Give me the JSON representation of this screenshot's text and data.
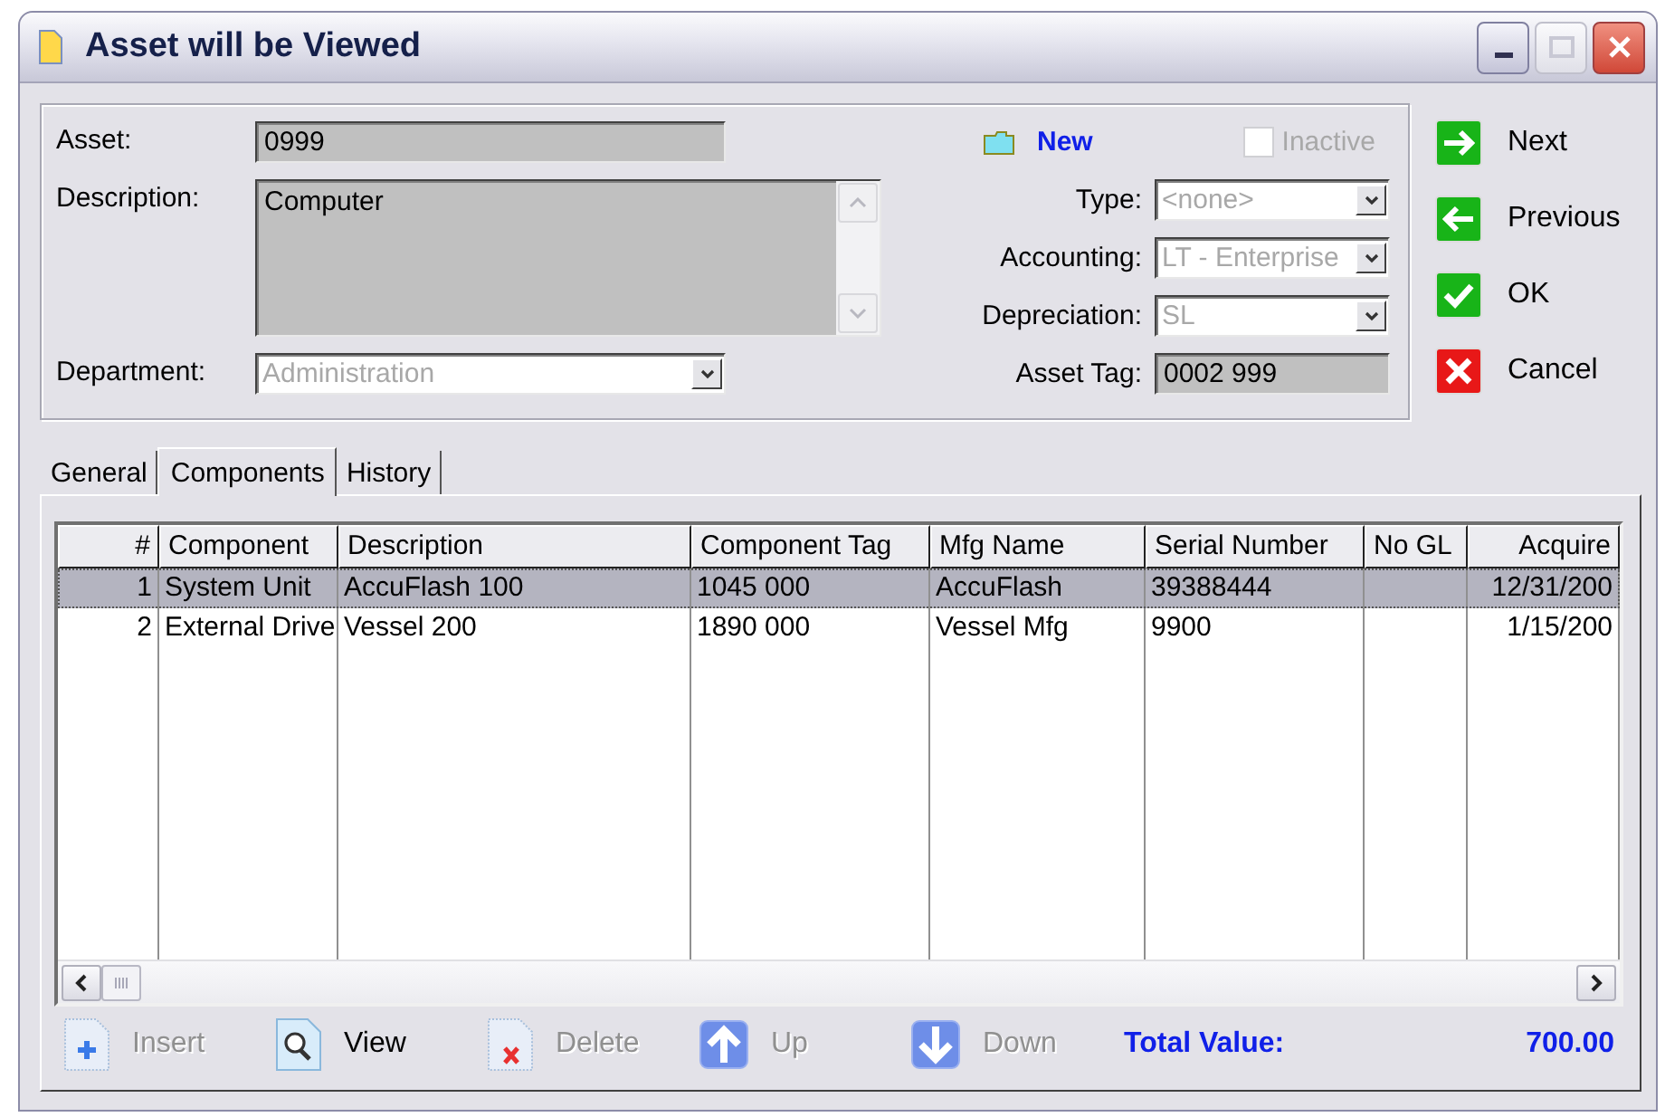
{
  "window": {
    "title": "Asset will be Viewed"
  },
  "asset_form": {
    "left_fields": [
      {
        "label": "Asset:",
        "kind": "text",
        "value": "0999"
      },
      {
        "label": "Description:",
        "kind": "memo",
        "value": "Computer"
      },
      {
        "label": "Department:",
        "kind": "combo",
        "value": "Administration",
        "disabled": true
      }
    ],
    "status": {
      "label": "New"
    },
    "inactive": {
      "label": "Inactive",
      "checked": false,
      "disabled": true
    },
    "right_fields": [
      {
        "label": "Type:",
        "kind": "combo",
        "value": "<none>",
        "disabled": true
      },
      {
        "label": "Accounting:",
        "kind": "combo",
        "value": "LT - Enterprise",
        "disabled": true
      },
      {
        "label": "Depreciation:",
        "kind": "combo",
        "value": "SL",
        "disabled": true
      },
      {
        "label": "Asset Tag:",
        "kind": "text",
        "value": "0002 999"
      }
    ]
  },
  "actions": [
    {
      "label": "Next",
      "kind": "next"
    },
    {
      "label": "Previous",
      "kind": "previous"
    },
    {
      "label": "OK",
      "kind": "ok"
    },
    {
      "label": "Cancel",
      "kind": "cancel"
    }
  ],
  "tabs": [
    {
      "label": "General",
      "selected": false
    },
    {
      "label": "Components",
      "selected": true
    },
    {
      "label": "History",
      "selected": false
    }
  ],
  "table": {
    "columns": [
      {
        "label": "#"
      },
      {
        "label": "Component"
      },
      {
        "label": "Description"
      },
      {
        "label": "Component Tag"
      },
      {
        "label": "Mfg Name"
      },
      {
        "label": "Serial Number"
      },
      {
        "label": "No GL"
      },
      {
        "label": "Acquire"
      }
    ],
    "rows": [
      {
        "selected": true,
        "cells": [
          "1",
          "System Unit",
          "AccuFlash 100",
          "1045 000",
          "AccuFlash",
          "39388444",
          "",
          "12/31/200"
        ]
      },
      {
        "selected": false,
        "cells": [
          "2",
          "External Drive",
          "Vessel 200",
          "1890 000",
          "Vessel Mfg",
          "9900",
          "",
          "1/15/200"
        ]
      }
    ]
  },
  "toolbar": [
    {
      "label": "Insert",
      "kind": "insert",
      "disabled": true
    },
    {
      "label": "View",
      "kind": "view",
      "disabled": false
    },
    {
      "label": "Delete",
      "kind": "delete",
      "disabled": true
    },
    {
      "label": "Up",
      "kind": "up",
      "disabled": true
    },
    {
      "label": "Down",
      "kind": "down",
      "disabled": true
    }
  ],
  "total": {
    "label": "Total Value:",
    "value": "700.00"
  }
}
